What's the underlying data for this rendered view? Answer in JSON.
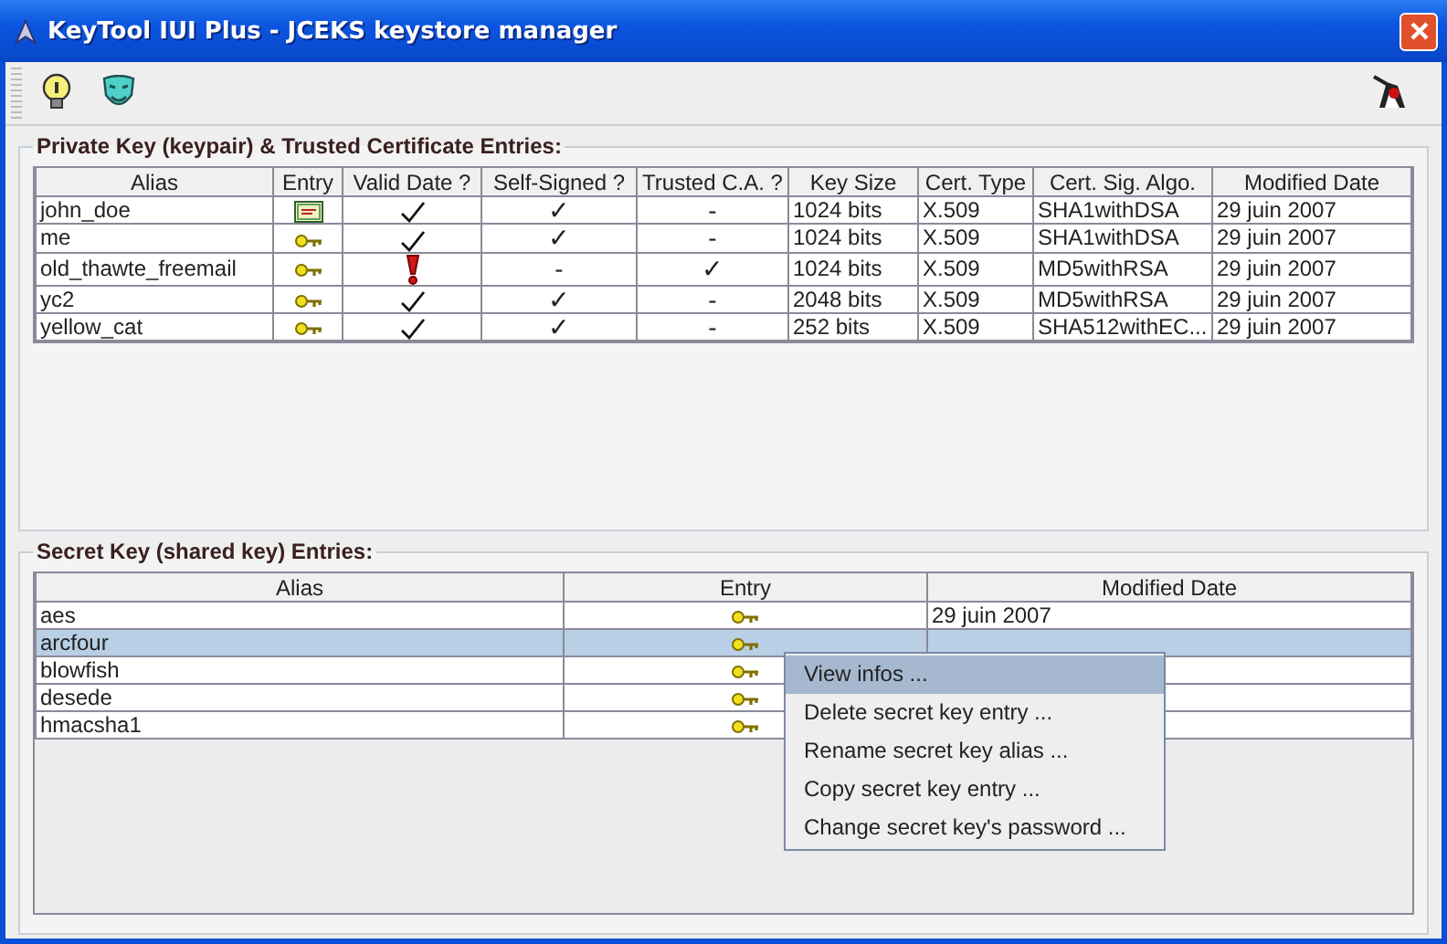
{
  "window": {
    "title": "KeyTool IUI Plus - JCEKS keystore manager"
  },
  "private_entries": {
    "title": "Private Key (keypair) & Trusted Certificate Entries:",
    "columns": [
      "Alias",
      "Entry",
      "Valid Date ?",
      "Self-Signed ?",
      "Trusted C.A. ?",
      "Key Size",
      "Cert. Type",
      "Cert. Sig. Algo.",
      "Modified Date"
    ],
    "rows": [
      {
        "alias": "john_doe",
        "entry": {
          "kind": "certificate"
        },
        "valid_date": true,
        "self_signed": "✓",
        "trusted_ca": "-",
        "key_size": "1024 bits",
        "cert_type": "X.509",
        "sig_algo": "SHA1withDSA",
        "modified": "29 juin 2007"
      },
      {
        "alias": "me",
        "entry": {
          "kind": "key"
        },
        "valid_date": true,
        "self_signed": "✓",
        "trusted_ca": "-",
        "key_size": "1024 bits",
        "cert_type": "X.509",
        "sig_algo": "SHA1withDSA",
        "modified": "29 juin 2007"
      },
      {
        "alias": "old_thawte_freemail",
        "entry": {
          "kind": "key"
        },
        "valid_date": false,
        "self_signed": "-",
        "trusted_ca": "✓",
        "key_size": "1024 bits",
        "cert_type": "X.509",
        "sig_algo": "MD5withRSA",
        "modified": "29 juin 2007"
      },
      {
        "alias": "yc2",
        "entry": {
          "kind": "key"
        },
        "valid_date": true,
        "self_signed": "✓",
        "trusted_ca": "-",
        "key_size": "2048 bits",
        "cert_type": "X.509",
        "sig_algo": "MD5withRSA",
        "modified": "29 juin 2007"
      },
      {
        "alias": "yellow_cat",
        "entry": {
          "kind": "key"
        },
        "valid_date": true,
        "self_signed": "✓",
        "trusted_ca": "-",
        "key_size": "252 bits",
        "cert_type": "X.509",
        "sig_algo": "SHA512withEC...",
        "modified": "29 juin 2007"
      }
    ]
  },
  "secret_entries": {
    "title": "Secret Key (shared key) Entries:",
    "columns": [
      "Alias",
      "Entry",
      "Modified Date"
    ],
    "rows": [
      {
        "alias": "aes",
        "entry": {
          "kind": "key"
        },
        "modified": "29 juin 2007",
        "selected": false
      },
      {
        "alias": "arcfour",
        "entry": {
          "kind": "key"
        },
        "selected": true
      },
      {
        "alias": "blowfish",
        "entry": {
          "kind": "key"
        },
        "selected": false
      },
      {
        "alias": "desede",
        "entry": {
          "kind": "key"
        },
        "selected": false
      },
      {
        "alias": "hmacsha1",
        "entry": {
          "kind": "key"
        },
        "selected": false
      }
    ]
  },
  "context_menu": {
    "items": [
      {
        "label": "View infos ...",
        "selected": true
      },
      {
        "label": "Delete secret key entry ...",
        "selected": false
      },
      {
        "label": "Rename secret key alias ...",
        "selected": false
      },
      {
        "label": "Copy secret key entry ...",
        "selected": false
      },
      {
        "label": "Change secret key's password ...",
        "selected": false
      }
    ]
  }
}
